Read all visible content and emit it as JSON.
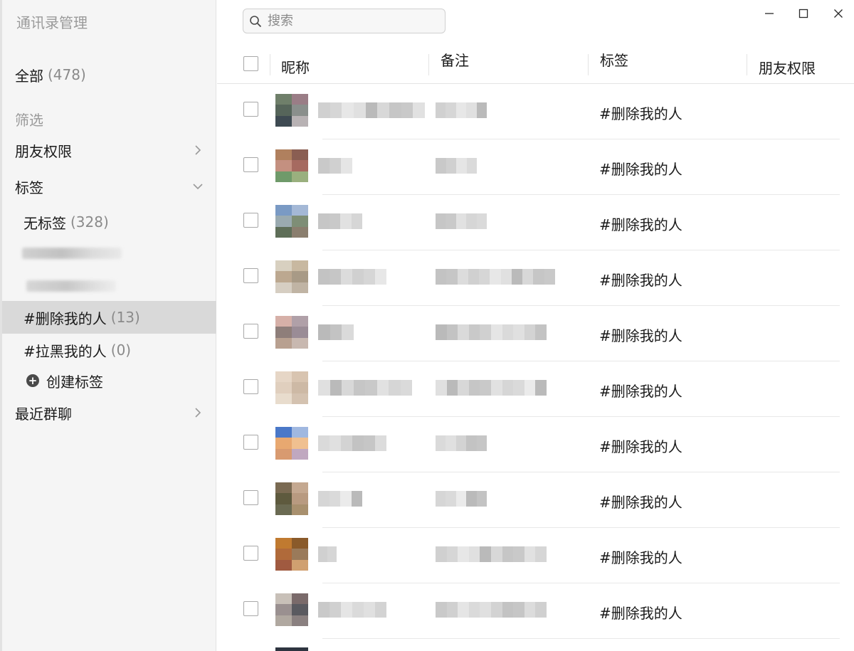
{
  "sidebar": {
    "title": "通讯录管理",
    "all": {
      "label": "全部",
      "count": "(478)"
    },
    "filter_label": "筛选",
    "friend_permission": "朋友权限",
    "tags": {
      "label": "标签",
      "items": [
        {
          "label": "无标签",
          "count": "(328)"
        },
        {
          "label": "#删除我的人",
          "count": "(13)"
        },
        {
          "label": "#拉黑我的人",
          "count": "(0)"
        }
      ],
      "create_label": "创建标签"
    },
    "recent_groups": "最近群聊"
  },
  "search": {
    "placeholder": "搜索"
  },
  "table": {
    "headers": {
      "nickname": "昵称",
      "remark": "备注",
      "tag": "标签",
      "permission": "朋友权限"
    },
    "rows": [
      {
        "tag": "#删除我的人"
      },
      {
        "tag": "#删除我的人"
      },
      {
        "tag": "#删除我的人"
      },
      {
        "tag": "#删除我的人"
      },
      {
        "tag": "#删除我的人"
      },
      {
        "tag": "#删除我的人"
      },
      {
        "tag": "#删除我的人"
      },
      {
        "tag": "#删除我的人"
      },
      {
        "tag": "#删除我的人"
      },
      {
        "tag": "#删除我的人"
      }
    ]
  },
  "colors": {
    "selected_bg": "#d9d9d9",
    "sidebar_bg": "#f5f5f5",
    "muted_text": "#9a9a9a"
  },
  "icons": {
    "search": "search-icon",
    "minimize": "minimize-icon",
    "maximize": "maximize-icon",
    "close": "close-icon",
    "chevron_right": "chevron-right-icon",
    "chevron_down": "chevron-down-icon",
    "plus": "plus-circle-icon"
  }
}
